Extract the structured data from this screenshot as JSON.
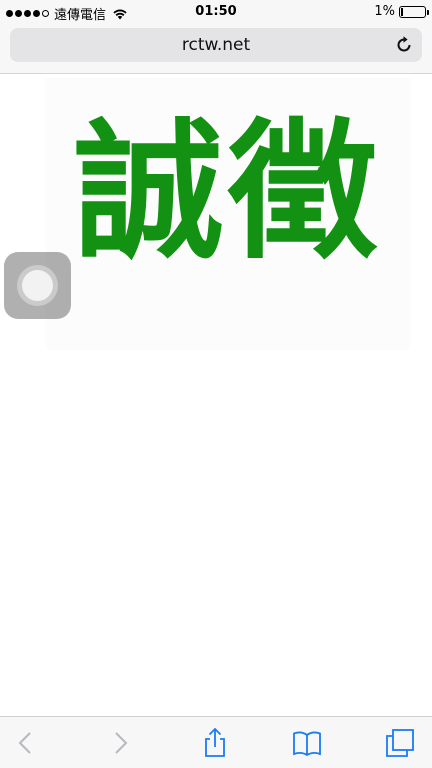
{
  "status_bar": {
    "carrier": "遠傳電信",
    "time": "01:50",
    "battery_percent": "1%",
    "battery_level": 0.01,
    "signal_bars_filled": 4,
    "signal_bars_total": 5
  },
  "address_bar": {
    "url": "rctw.net",
    "reload_icon": "reload-icon"
  },
  "page": {
    "logo_text": "誠徵",
    "logo_color": "#129112"
  },
  "toolbar": {
    "icons": [
      "back-icon",
      "forward-icon",
      "share-icon",
      "bookmarks-icon",
      "tabs-icon"
    ],
    "accent_color": "#1a7cf5",
    "disabled_color": "#b8b8bd"
  }
}
